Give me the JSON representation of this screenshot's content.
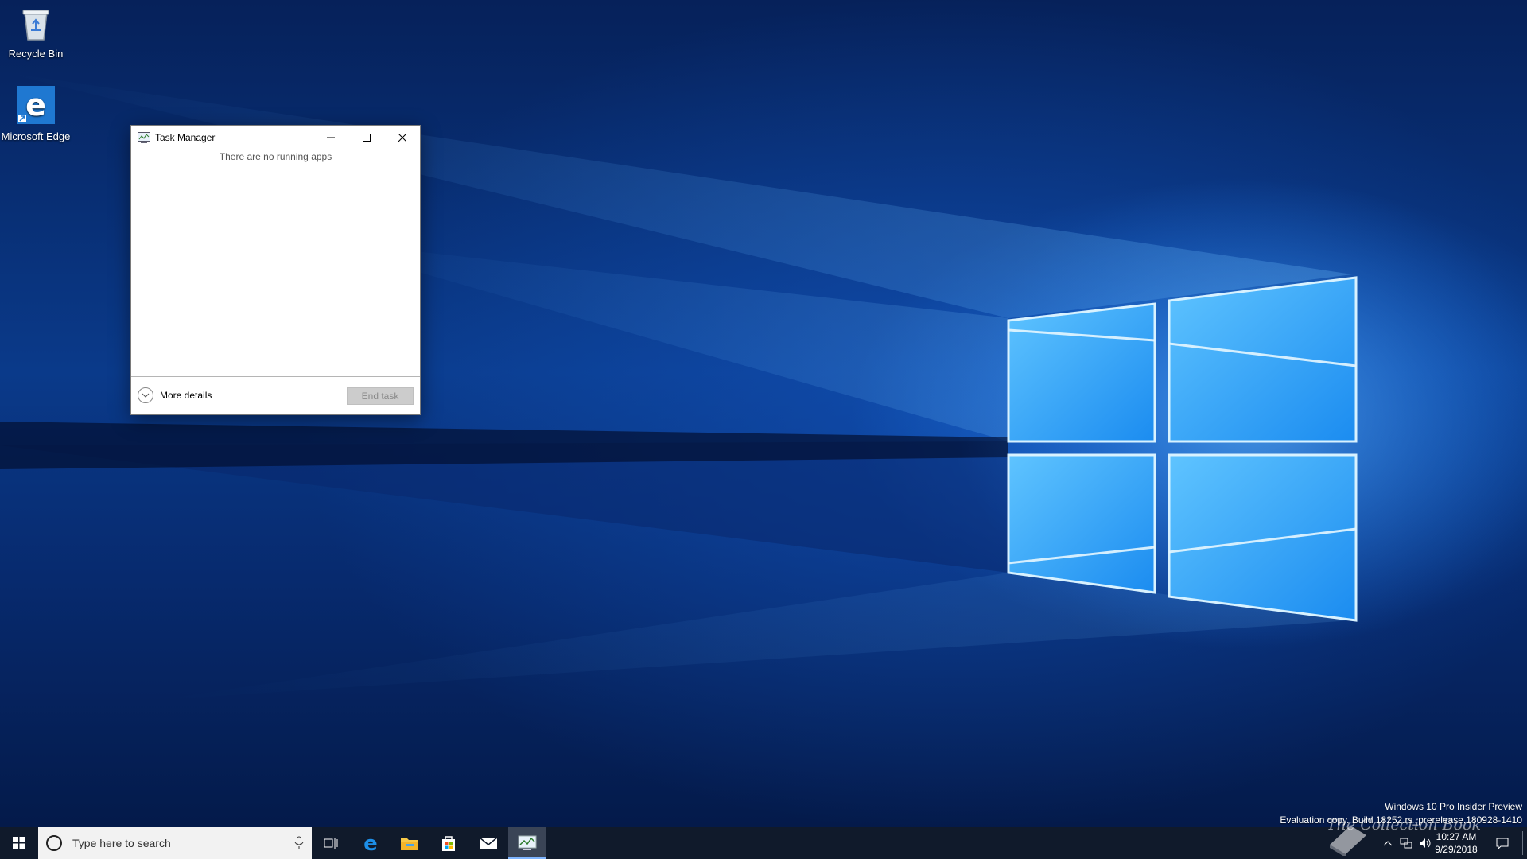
{
  "desktop": {
    "icons": [
      {
        "label": "Recycle Bin",
        "icon": "recycle-bin-icon"
      },
      {
        "label": "Microsoft Edge",
        "icon": "edge-icon"
      }
    ],
    "watermark": {
      "line1": "Windows 10 Pro Insider Preview",
      "line2": "Evaluation copy. Build 18252.rs_prerelease.180928-1410"
    },
    "logo_text": "The Collection Book"
  },
  "task_manager": {
    "title": "Task Manager",
    "empty_message": "There are no running apps",
    "more_details": "More details",
    "end_task": "End task",
    "colors": {
      "window_bg": "#ffffff",
      "button_disabled_bg": "#cccccc",
      "button_disabled_text": "#8a8a8a"
    }
  },
  "taskbar": {
    "search_placeholder": "Type here to search",
    "pinned": [
      "task-view-icon",
      "edge-icon",
      "file-explorer-icon",
      "store-icon",
      "mail-icon",
      "task-manager-icon"
    ],
    "active_app": "task-manager-icon",
    "clock": {
      "time": "10:27 AM",
      "date": "9/29/2018"
    },
    "background": "#101a2b"
  }
}
